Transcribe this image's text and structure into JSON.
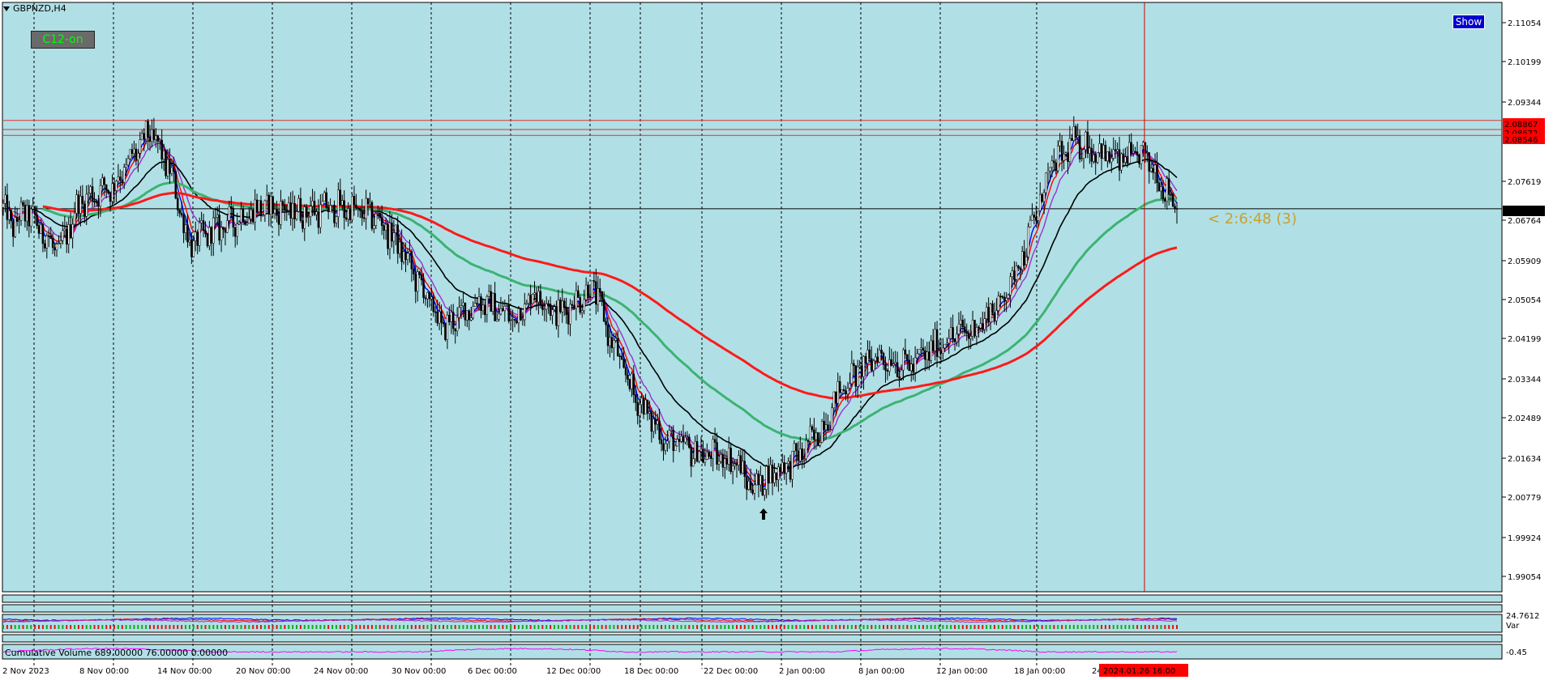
{
  "symbol_label": "GBPNZD,H4",
  "indicator_button": "C12-on",
  "show_button": "Show",
  "countdown": "< 2:6:48 (3)",
  "cumulative_volume_label": "Cumulative Volume 689.00000 76.00000 0.00000",
  "colors": {
    "chart_bg": "#b0e0e6",
    "ma_fast": "#0000ff",
    "ma_red": "#ff0000",
    "ma_purple": "#9b30d0",
    "ma_black": "#000000",
    "ma_green": "#3cb371",
    "ma_slow_red": "#ff1a1a",
    "price_label_red": "#ff0000",
    "price_label_black": "#000000",
    "countdown": "#c8a032"
  },
  "price_axis": {
    "ticks": [
      "2.11054",
      "2.10199",
      "2.09344",
      "2.07619",
      "2.06764",
      "2.05909",
      "2.05054",
      "2.04199",
      "2.03344",
      "2.02489",
      "2.01634",
      "2.00779",
      "1.99924",
      "1.99054"
    ],
    "highlighted": [
      {
        "text": "2.08867",
        "style": "red"
      },
      {
        "text": "2.08672",
        "style": "red"
      },
      {
        "text": "2.08546",
        "style": "red"
      },
      {
        "text": "2.06971",
        "style": "black"
      }
    ],
    "subpanel_labels": [
      "24.7612",
      "Var",
      "-0.45"
    ]
  },
  "time_axis": {
    "labels": [
      "2 Nov 2023",
      "8 Nov 00:00",
      "14 Nov 00:00",
      "20 Nov 00:00",
      "24 Nov 00:00",
      "30 Nov 00:00",
      "6 Dec 00:00",
      "12 Dec 00:00",
      "18 Dec 00:00",
      "22 Dec 00:00",
      "2 Jan 00:00",
      "8 Jan 00:00",
      "12 Jan 00:00",
      "18 Jan 00:00",
      "24 Jan 00:00"
    ],
    "cursor_label": "2024.01.26 16:00"
  },
  "chart_data": {
    "type": "candlestick",
    "symbol": "GBPNZD",
    "timeframe": "H4",
    "ylim": [
      1.9875,
      2.114
    ],
    "current_price": 2.06971,
    "resistance_lines": [
      2.08867,
      2.08672,
      2.08546
    ],
    "anchors": [
      [
        0,
        2.07
      ],
      [
        4,
        2.066
      ],
      [
        12,
        2.069
      ],
      [
        28,
        2.06
      ],
      [
        38,
        2.071
      ],
      [
        56,
        2.075
      ],
      [
        74,
        2.086
      ],
      [
        84,
        2.078
      ],
      [
        94,
        2.062
      ],
      [
        110,
        2.066
      ],
      [
        130,
        2.07
      ],
      [
        150,
        2.069
      ],
      [
        170,
        2.07
      ],
      [
        188,
        2.068
      ],
      [
        198,
        2.063
      ],
      [
        212,
        2.052
      ],
      [
        222,
        2.044
      ],
      [
        240,
        2.05
      ],
      [
        258,
        2.046
      ],
      [
        268,
        2.052
      ],
      [
        280,
        2.047
      ],
      [
        298,
        2.053
      ],
      [
        306,
        2.042
      ],
      [
        318,
        2.03
      ],
      [
        334,
        2.02
      ],
      [
        352,
        2.017
      ],
      [
        368,
        2.016
      ],
      [
        378,
        2.01
      ],
      [
        392,
        2.014
      ],
      [
        400,
        2.016
      ],
      [
        412,
        2.022
      ],
      [
        424,
        2.032
      ],
      [
        440,
        2.038
      ],
      [
        458,
        2.036
      ],
      [
        476,
        2.042
      ],
      [
        490,
        2.044
      ],
      [
        504,
        2.05
      ],
      [
        516,
        2.062
      ],
      [
        528,
        2.078
      ],
      [
        540,
        2.084
      ],
      [
        548,
        2.083
      ],
      [
        562,
        2.08
      ],
      [
        576,
        2.081
      ],
      [
        592,
        2.07
      ]
    ],
    "moving_averages": [
      {
        "color": "#0000ff",
        "period": 5
      },
      {
        "color": "#ff0000",
        "period": 8
      },
      {
        "color": "#9b30d0",
        "period": 14
      },
      {
        "color": "#000000",
        "period": 36
      },
      {
        "color": "#3cb371",
        "period": 90
      },
      {
        "color": "#ff1a1a",
        "period": 180
      }
    ]
  }
}
